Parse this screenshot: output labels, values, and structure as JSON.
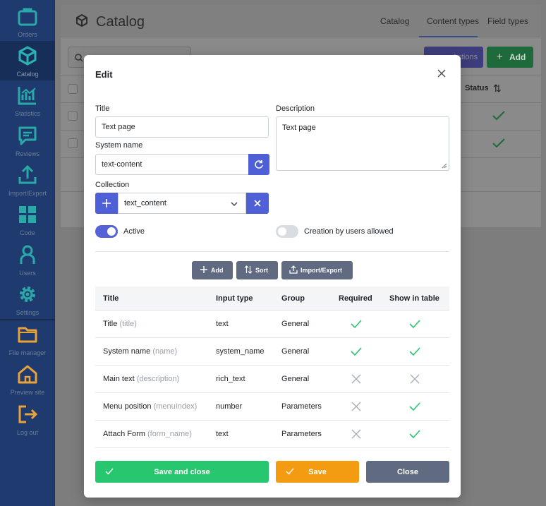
{
  "sidebar": {
    "items": [
      {
        "label": "Orders",
        "icon": "orders-icon"
      },
      {
        "label": "Catalog",
        "icon": "catalog-cube-icon",
        "active": true
      },
      {
        "label": "Statistics",
        "icon": "statistics-chart-icon"
      },
      {
        "label": "Reviews",
        "icon": "reviews-chat-icon"
      },
      {
        "label": "Import/Export",
        "icon": "upload-icon"
      },
      {
        "label": "Code",
        "icon": "code-blocks-icon"
      },
      {
        "label": "Users",
        "icon": "user-icon"
      },
      {
        "label": "Settings",
        "icon": "gear-icon"
      },
      {
        "label": "File manager",
        "icon": "folder-icon"
      },
      {
        "label": "Preview site",
        "icon": "home-icon"
      },
      {
        "label": "Log out",
        "icon": "logout-icon"
      }
    ]
  },
  "page": {
    "title": "Catalog",
    "tabs": [
      "Catalog",
      "Content types",
      "Field types"
    ],
    "active_tab": "Content types",
    "actions_label": "Actions",
    "add_label": "Add",
    "status_header": "Status"
  },
  "modal": {
    "title": "Edit",
    "title_label": "Title",
    "title_value": "Text page",
    "system_name_label": "System name",
    "system_name_value": "text-content",
    "description_label": "Description",
    "description_value": "Text page",
    "collection_label": "Collection",
    "collection_value": "text_content",
    "active_label": "Active",
    "active_on": true,
    "creation_label": "Creation by users allowed",
    "creation_on": false,
    "toolbar": {
      "add": "Add",
      "sort": "Sort",
      "import_export": "Import/Export"
    },
    "table": {
      "headers": [
        "Title",
        "Input type",
        "Group",
        "Required",
        "Show in table"
      ],
      "rows": [
        {
          "title": "Title",
          "name": "(title)",
          "input_type": "text",
          "group": "General",
          "required": true,
          "show_in_table": true
        },
        {
          "title": "System name",
          "name": "(name)",
          "input_type": "system_name",
          "group": "General",
          "required": true,
          "show_in_table": true
        },
        {
          "title": "Main text",
          "name": "(description)",
          "input_type": "rich_text",
          "group": "General",
          "required": false,
          "show_in_table": false
        },
        {
          "title": "Menu position",
          "name": "(menuIndex)",
          "input_type": "number",
          "group": "Parameters",
          "required": false,
          "show_in_table": true
        },
        {
          "title": "Attach Form",
          "name": "(form_name)",
          "input_type": "text",
          "group": "Parameters",
          "required": false,
          "show_in_table": true
        }
      ]
    },
    "footer": {
      "save_close": "Save and close",
      "save": "Save",
      "close": "Close"
    }
  },
  "colors": {
    "sidebar": "#1e3a6e",
    "icon_teal": "#2bb3b0",
    "icon_orange": "#e8a33a",
    "primary": "#4f5fd6",
    "success": "#28c76f",
    "warning": "#f39c12",
    "secondary": "#606a80"
  }
}
